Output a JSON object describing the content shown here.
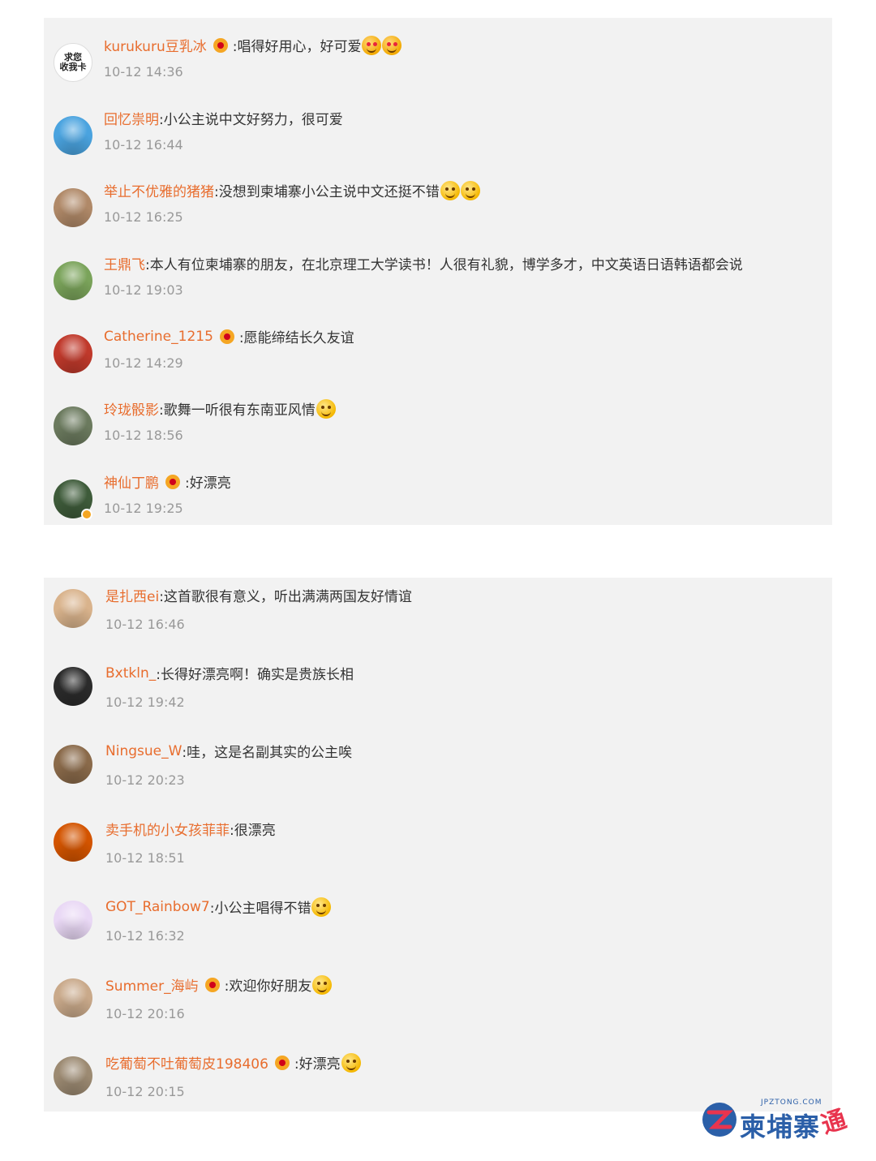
{
  "colors": {
    "username": "#e86d2e",
    "text": "#333333",
    "time": "#999999",
    "panel": "#f2f2f2",
    "logo_blue": "#2b5fa8",
    "logo_red": "#e8344e"
  },
  "panel1": {
    "comments": [
      {
        "user": "kurukuru豆乳冰",
        "badge": true,
        "text": ":唱得好用心，好可爱",
        "emojis": [
          "heart-eyes-emoji",
          "heart-eyes-emoji"
        ],
        "time": "10-12 14:36",
        "avatar_text": "求您\n收我卡"
      },
      {
        "user": "回忆祟明",
        "badge": false,
        "text": ":小公主说中文好努力，很可爱",
        "emojis": [],
        "time": "10-12 16:44"
      },
      {
        "user": "举止不优雅的猪猪",
        "badge": false,
        "text": ":没想到柬埔寨小公主说中文还挺不错",
        "emojis": [
          "surprised-emoji",
          "surprised-emoji"
        ],
        "time": "10-12 16:25"
      },
      {
        "user": "王鼎飞",
        "badge": false,
        "text": ":本人有位柬埔寨的朋友，在北京理工大学读书！人很有礼貌，博学多才，中文英语日语韩语都会说",
        "emojis": [],
        "time": "10-12 19:03"
      },
      {
        "user": "Catherine_1215",
        "badge": true,
        "text": ":愿能缔结长久友谊",
        "emojis": [],
        "time": "10-12 14:29"
      },
      {
        "user": "玲珑骰影",
        "badge": false,
        "text": ":歌舞一听很有东南亚风情",
        "emojis": [
          "grin-emoji"
        ],
        "time": "10-12 18:56"
      },
      {
        "user": "神仙丁鹏",
        "badge": true,
        "text": ":好漂亮",
        "emojis": [],
        "time": "10-12 19:25",
        "verified": true
      }
    ]
  },
  "panel2": {
    "comments": [
      {
        "user": "是扎西ei",
        "badge": false,
        "text": ":这首歌很有意义，听出满满两国友好情谊",
        "emojis": [],
        "time": "10-12 16:46"
      },
      {
        "user": "Bxtkln_",
        "badge": false,
        "text": ":长得好漂亮啊！确实是贵族长相",
        "emojis": [],
        "time": "10-12 19:42"
      },
      {
        "user": "Ningsue_W",
        "badge": false,
        "text": ":哇，这是名副其实的公主唉",
        "emojis": [],
        "time": "10-12 20:23"
      },
      {
        "user": "卖手机的小女孩菲菲",
        "badge": false,
        "text": ":很漂亮",
        "emojis": [],
        "time": "10-12 18:51"
      },
      {
        "user": "GOT_Rainbow7",
        "badge": false,
        "text": ":小公主唱得不错",
        "emojis": [
          "cheer-emoji"
        ],
        "time": "10-12 16:32"
      },
      {
        "user": "Summer_海屿",
        "badge": true,
        "text": ":欢迎你好朋友",
        "emojis": [
          "hug-emoji"
        ],
        "time": "10-12 20:16"
      },
      {
        "user": "吃葡萄不吐葡萄皮198406",
        "badge": true,
        "text": ":好漂亮",
        "emojis": [
          "smile-emoji"
        ],
        "time": "10-12 20:15"
      }
    ]
  },
  "logo": {
    "domain": "JPZTONG.COM",
    "text": "柬埔寨",
    "tong": "通"
  }
}
